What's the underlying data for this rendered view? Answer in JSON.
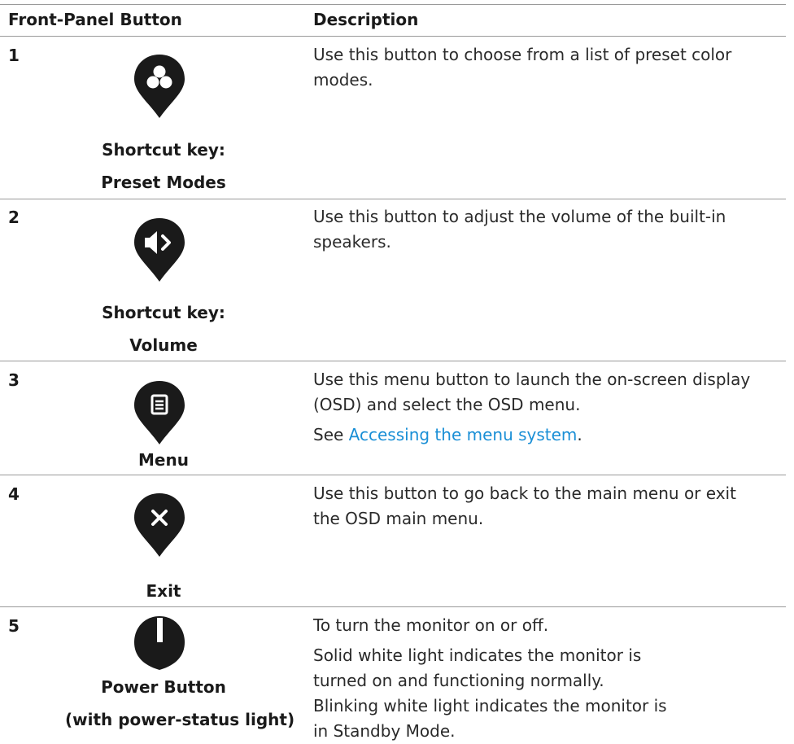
{
  "table": {
    "headers": {
      "button": "Front-Panel Button",
      "description": "Description"
    },
    "rows": [
      {
        "number": "1",
        "icon": "preset-modes-icon",
        "label_lines": [
          "Shortcut key:",
          "Preset Modes"
        ],
        "description": [
          "Use this button to choose from a list of preset color modes."
        ]
      },
      {
        "number": "2",
        "icon": "volume-icon",
        "label_lines": [
          "Shortcut key:",
          "Volume"
        ],
        "description": [
          "Use this button to adjust the volume of the built-in speakers."
        ]
      },
      {
        "number": "3",
        "icon": "menu-icon",
        "label_lines": [
          "Menu"
        ],
        "description": [
          "Use this menu button to launch the on-screen display (OSD) and select the OSD menu."
        ],
        "see_prefix": "See ",
        "see_link": "Accessing the menu system",
        "see_suffix": "."
      },
      {
        "number": "4",
        "icon": "exit-icon",
        "label_lines": [
          "Exit"
        ],
        "description": [
          "Use this button to go back to the main menu or exit the OSD main menu."
        ]
      },
      {
        "number": "5",
        "icon": "power-icon",
        "label_lines": [
          "Power Button",
          "(with power-status light)"
        ],
        "description": [
          "To turn the monitor on or off.",
          "Solid white light indicates the monitor is turned on and functioning normally. Blinking white light indicates the monitor is in Standby Mode."
        ]
      }
    ]
  },
  "colors": {
    "icon": "#1a1a1a",
    "link": "#1a8fd6",
    "rule": "#9a9a9a"
  }
}
